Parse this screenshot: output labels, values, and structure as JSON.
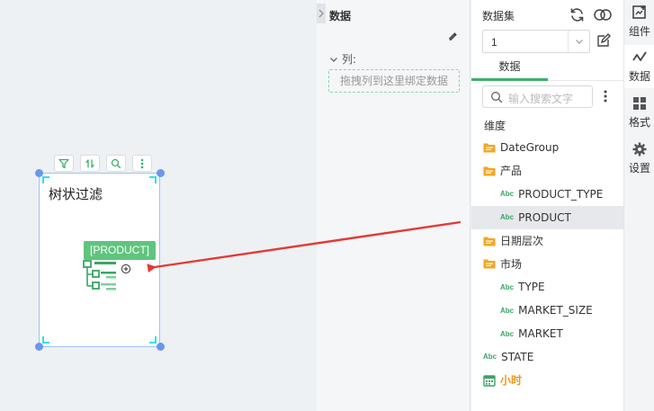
{
  "canvas": {
    "widget_title": "树状过滤",
    "product_tag": "[PRODUCT]"
  },
  "data_panel": {
    "title": "数据",
    "column_label": "列:",
    "drop_hint": "拖拽列到这里绑定数据"
  },
  "dataset_panel": {
    "title": "数据集",
    "selected_dataset": "1",
    "tab_label": "数据",
    "search_placeholder": "输入搜索文字",
    "dimension_label": "维度",
    "fields": [
      {
        "label": "DateGroup",
        "icon": "folder-icon",
        "indent": 0
      },
      {
        "label": "产品",
        "icon": "folder-icon",
        "indent": 0
      },
      {
        "label": "PRODUCT_TYPE",
        "icon": "abc-icon",
        "indent": 1
      },
      {
        "label": "PRODUCT",
        "icon": "abc-icon",
        "indent": 1,
        "selected": true
      },
      {
        "label": "日期层次",
        "icon": "folder-icon",
        "indent": 0
      },
      {
        "label": "市场",
        "icon": "folder-icon",
        "indent": 0
      },
      {
        "label": "TYPE",
        "icon": "abc-icon",
        "indent": 1
      },
      {
        "label": "MARKET_SIZE",
        "icon": "abc-icon",
        "indent": 1
      },
      {
        "label": "MARKET",
        "icon": "abc-icon",
        "indent": 1
      },
      {
        "label": "STATE",
        "icon": "abc-icon",
        "indent": 0
      },
      {
        "label": "小时",
        "icon": "calendar-icon",
        "indent": 0,
        "highlight": true
      }
    ],
    "abc_text": "Abc"
  },
  "right_tabs": [
    {
      "label": "组件",
      "icon": "component-icon"
    },
    {
      "label": "数据",
      "icon": "data-icon",
      "active": true
    },
    {
      "label": "格式",
      "icon": "format-icon"
    },
    {
      "label": "设置",
      "icon": "gear-icon"
    }
  ],
  "colors": {
    "accent_green": "#3bb06a",
    "folder_orange": "#f5a623",
    "arrow_red": "#e53935",
    "selection_blue": "#6c96ee"
  }
}
